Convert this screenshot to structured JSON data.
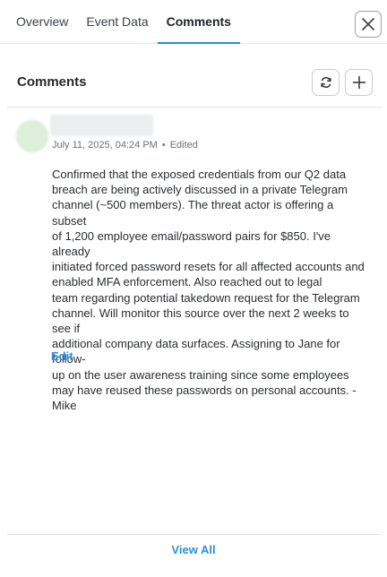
{
  "tabs": [
    {
      "label": "Overview",
      "active": false
    },
    {
      "label": "Event Data",
      "active": false
    },
    {
      "label": "Comments",
      "active": true
    }
  ],
  "icons": {
    "close": "close-icon",
    "refresh": "refresh-icon",
    "add": "plus-icon"
  },
  "colors": {
    "accent": "#1f8ee8",
    "link": "#2a8fe0",
    "avatar": "#dcefd9"
  },
  "comments_section": {
    "title": "Comments"
  },
  "comment": {
    "date": "July 11, 2025, 04:24 PM",
    "separator": "•",
    "status": "Edited",
    "body": "Confirmed that the exposed credentials from our Q2 data\nbreach are being actively discussed in a private Telegram\nchannel (~500 members). The threat actor is offering a subset\nof 1,200 employee email/password pairs for $850. I've already\ninitiated forced password resets for all affected accounts and\nenabled MFA enforcement. Also reached out to legal\nteam regarding potential takedown request for the Telegram\nchannel. Will monitor this source over the next 2 weeks to see if\nadditional company data surfaces. Assigning to Jane for follow-\nup on the user awareness training since some employees\nmay have reused these passwords on personal accounts. -Mike",
    "edit_label": "Edit"
  },
  "footer": {
    "view_all_label": "View All"
  }
}
